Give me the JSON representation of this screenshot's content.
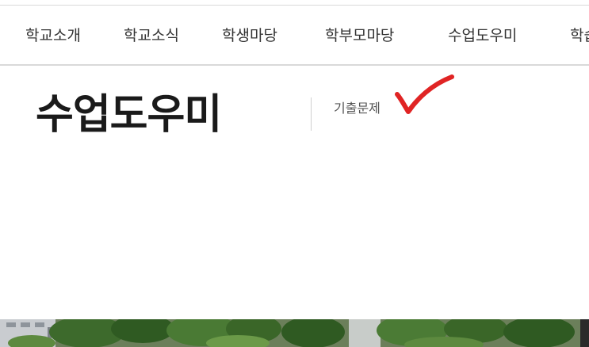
{
  "nav": {
    "items": [
      {
        "label": "학교소개"
      },
      {
        "label": "학교소식"
      },
      {
        "label": "학생마당"
      },
      {
        "label": "학부모마당"
      },
      {
        "label": "수업도우미"
      },
      {
        "label": "학습"
      }
    ]
  },
  "subpage": {
    "title": "수업도우미",
    "submenu": [
      {
        "label": "기출문제"
      }
    ]
  },
  "annotation": {
    "color": "#e02424",
    "icon": "checkmark-icon"
  }
}
